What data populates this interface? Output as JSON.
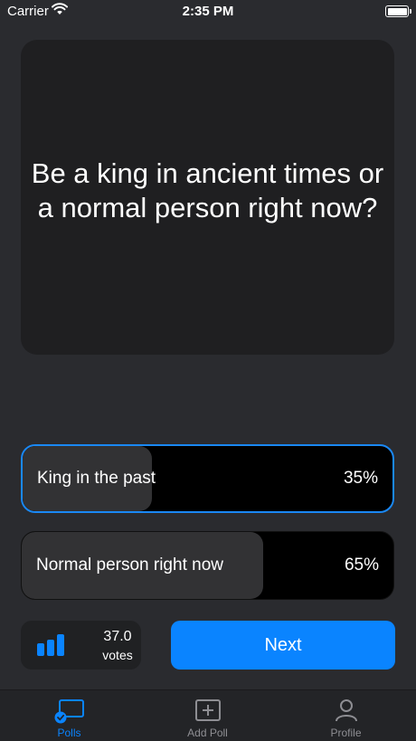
{
  "status_bar": {
    "carrier": "Carrier",
    "time": "2:35 PM"
  },
  "question": {
    "text": "Be a king in ancient times or a normal person right now?"
  },
  "options": [
    {
      "label": "King in the past",
      "percent_text": "35%",
      "percent": 35,
      "selected": true
    },
    {
      "label": "Normal person right now",
      "percent_text": "65%",
      "percent": 65,
      "selected": false
    }
  ],
  "votes": {
    "count": "37.0",
    "label": "votes",
    "icon": "bar-chart-icon"
  },
  "next_button": {
    "label": "Next"
  },
  "tabs": [
    {
      "label": "Polls",
      "icon": "polls-icon",
      "active": true
    },
    {
      "label": "Add Poll",
      "icon": "add-poll-icon",
      "active": false
    },
    {
      "label": "Profile",
      "icon": "profile-icon",
      "active": false
    }
  ],
  "colors": {
    "accent": "#0a84ff",
    "background": "#2a2b2f",
    "card": "#1f1f21"
  }
}
